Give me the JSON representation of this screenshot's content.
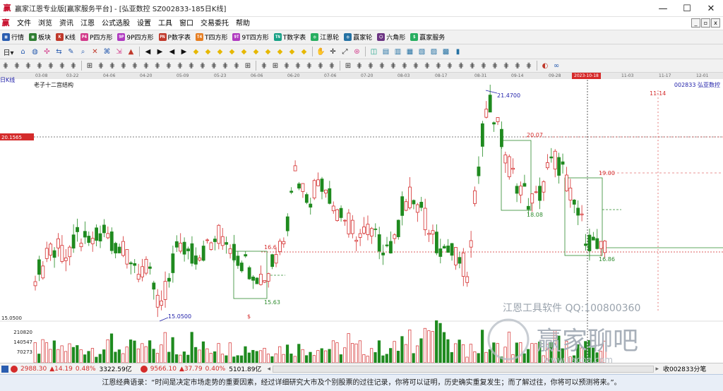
{
  "window": {
    "title": "赢家江恩专业版[赢家服务平台] - [弘亚数控  SZ002833-185日K线]",
    "logo": "赢",
    "controls": [
      "—",
      "☐",
      "✕"
    ]
  },
  "menu": [
    "文件",
    "浏览",
    "资讯",
    "江恩",
    "公式选股",
    "设置",
    "工具",
    "窗口",
    "交易委托",
    "帮助"
  ],
  "mdi_controls": [
    "_",
    "▫",
    "x"
  ],
  "toolbar1": [
    {
      "label": "行情",
      "icon": "grid-icon",
      "color": "#2a5db0",
      "glyph": "▦"
    },
    {
      "label": "板块",
      "icon": "blocks-icon",
      "color": "#2f7d32",
      "glyph": "▩"
    },
    {
      "label": "K线",
      "icon": "kline-icon",
      "color": "#c0392b",
      "glyph": "K"
    },
    {
      "label": "P四方形",
      "icon": "p-square-icon",
      "color": "#d23a8a",
      "glyph": "P4"
    },
    {
      "label": "9P四方形",
      "icon": "9p-square-icon",
      "color": "#b03ac0",
      "glyph": "9P"
    },
    {
      "label": "P数字表",
      "icon": "p-table-icon",
      "color": "#c0392b",
      "glyph": "PN"
    },
    {
      "label": "T四方形",
      "icon": "t-square-icon",
      "color": "#e67e22",
      "glyph": "T4"
    },
    {
      "label": "9T四方形",
      "icon": "9t-square-icon",
      "color": "#b03ac0",
      "glyph": "9T"
    },
    {
      "label": "T数字表",
      "icon": "t-table-icon",
      "color": "#16a085",
      "glyph": "TN"
    },
    {
      "label": "江恩轮",
      "icon": "gann-wheel-icon",
      "color": "#27ae60",
      "glyph": "◎"
    },
    {
      "label": "赢家轮",
      "icon": "winner-wheel-icon",
      "color": "#2471a3",
      "glyph": "◎"
    },
    {
      "label": "六角形",
      "icon": "hexagon-icon",
      "color": "#6c3483",
      "glyph": "⬡"
    },
    {
      "label": "赢家服务",
      "icon": "service-icon",
      "color": "#27ae60",
      "glyph": "$"
    }
  ],
  "toolbar2": [
    "日▾",
    "⌂",
    "◍",
    "✣",
    "⇆",
    "✎",
    "⌕",
    "✕",
    "⌘",
    "⇲",
    "▲",
    "◀",
    "▶",
    "◀",
    "▶",
    "◆",
    "◆",
    "◆",
    "◆",
    "◆",
    "◆",
    "◆",
    "◆",
    "◆",
    "◆",
    "✋",
    "✛",
    "⤢",
    "⊛",
    "◫",
    "▤",
    "▥",
    "▦",
    "▧",
    "▨",
    "▩",
    "▮"
  ],
  "toolbar3": [
    "⋕",
    "⋕",
    "⋕",
    "⋕",
    "⋕",
    "⋕",
    "⋕",
    "⊞",
    "⋕",
    "⋕",
    "⋕",
    "⋕",
    "⋕",
    "⋕",
    "⋕",
    "⋕",
    "⋕",
    "⋕",
    "⋕",
    "⋕",
    "⋕",
    "⊞",
    "⋕",
    "⊞",
    "⋕",
    "⋕",
    "⋕",
    "⋕",
    "⋕",
    "⊞",
    "⋕",
    "⋕",
    "⋕",
    "⋕",
    "⋕",
    "⋕",
    "⋕",
    "⋕",
    "⋕",
    "⋕",
    "⋕",
    "⋕",
    "⋕",
    "⋕",
    "⋕",
    "⋕",
    "◐",
    "∞"
  ],
  "chart_meta": {
    "period_label": "日K线",
    "structure_label": "老子十二宫结构",
    "stock_label": "002833  弘亚数控",
    "cursor_date": "2023-10-18",
    "future_date_label": "11-14",
    "dates": [
      "03-08",
      "03-22",
      "04-06",
      "04-20",
      "05-09",
      "05-23",
      "06-06",
      "06-20",
      "07-06",
      "07-20",
      "08-03",
      "08-17",
      "08-31",
      "09-14",
      "09-28",
      "2023-10-18",
      "11-03",
      "11-17",
      "12-01"
    ],
    "levels": {
      "top_line": "20.1565",
      "high_price": "21.4700",
      "low_price": "15.0500",
      "box_low1": "15.63",
      "box_high2": "20.07",
      "box_low2": "18.08",
      "box_high3": "19.00",
      "box_low3": "16.86",
      "mid_level": "16.6",
      "min_label": "15.0500",
      "dollar": "$"
    },
    "volume_labels": [
      "210820",
      "140547",
      "70273"
    ],
    "watermark1": "江恩工具软件  QQ:100800360",
    "watermark2": "赢家聊吧",
    "watermark3": "www.jiaoba.com"
  },
  "chart_data": {
    "type": "candlestick",
    "x": [
      "03-08",
      "03-22",
      "04-06",
      "04-20",
      "05-09",
      "05-23",
      "06-06",
      "06-20",
      "07-06",
      "07-20",
      "08-03",
      "08-17",
      "08-31",
      "09-14",
      "09-28",
      "2023-10-18"
    ],
    "close": [
      16.3,
      17.4,
      16.9,
      15.2,
      16.9,
      17.2,
      16.3,
      18.1,
      18.6,
      17.3,
      18.5,
      16.6,
      21.0,
      18.4,
      19.5,
      16.86
    ],
    "ylim": [
      15.05,
      21.47
    ],
    "annotations": [
      "21.4700",
      "20.07",
      "19.00",
      "18.08",
      "16.86",
      "15.63",
      "15.0500"
    ]
  },
  "status": {
    "index1": "2988.30",
    "change1": "▲14.19",
    "pct1": "0.48%",
    "amount1": "3322.59亿",
    "index2": "9566.10",
    "change2": "▲37.79",
    "pct2": "0.40%",
    "amount2": "5101.89亿",
    "right_text": "收002833分笔"
  },
  "quote": "江恩经典语录：“时间是决定市场走势的重要因素，经过详细研究大市及个别股票的过往记录，你将可以证明，历史确实重复发生；而了解过往，你将可以预测将来。”。"
}
